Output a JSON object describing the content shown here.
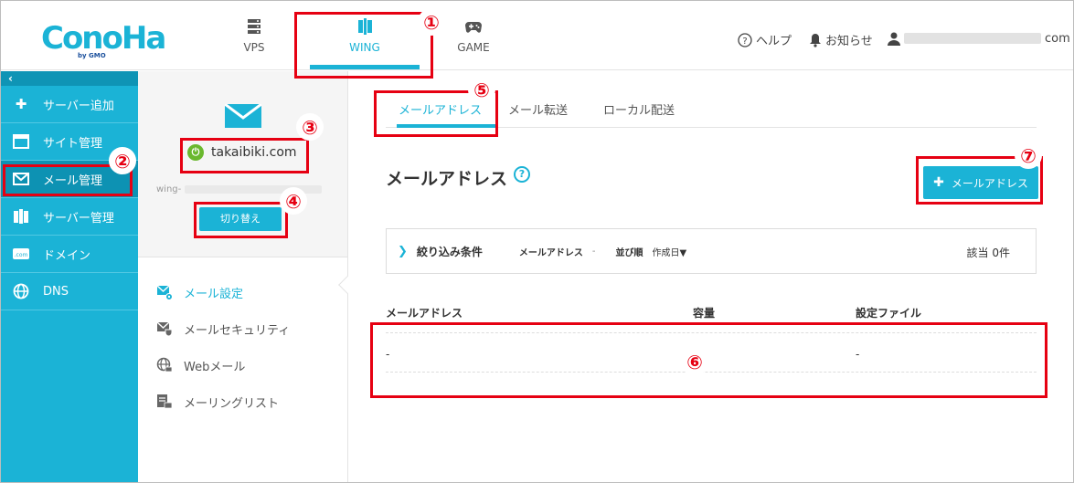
{
  "brand": {
    "logo_text": "ConoHa",
    "logo_sub": "by GMO"
  },
  "top_tabs": [
    {
      "label": "VPS"
    },
    {
      "label": "WING"
    },
    {
      "label": "GAME"
    }
  ],
  "header_utils": {
    "help": "ヘルプ",
    "news": "お知らせ",
    "account_suffix": "com"
  },
  "sidebar": {
    "collapse": "‹",
    "items": [
      {
        "label": "サーバー追加"
      },
      {
        "label": "サイト管理"
      },
      {
        "label": "メール管理"
      },
      {
        "label": "サーバー管理"
      },
      {
        "label": "ドメイン"
      },
      {
        "label": "DNS"
      }
    ]
  },
  "mid": {
    "domain": "takaibiki.com",
    "power_glyph": "⏻",
    "server_prefix": "wing-",
    "switch_button": "切り替え",
    "submenu": [
      {
        "label": "メール設定"
      },
      {
        "label": "メールセキュリティ"
      },
      {
        "label": "Webメール"
      },
      {
        "label": "メーリングリスト"
      }
    ]
  },
  "main": {
    "tabs": [
      {
        "label": "メールアドレス"
      },
      {
        "label": "メール転送"
      },
      {
        "label": "ローカル配送"
      }
    ],
    "title": "メールアドレス",
    "help_glyph": "?",
    "add_button": "メールアドレス",
    "filter": {
      "label": "絞り込み条件",
      "field_label": "メールアドレス",
      "field_value": "-",
      "sort_label": "並び順",
      "sort_value": "作成日▼",
      "count": "該当 0件"
    },
    "table": {
      "headers": [
        "メールアドレス",
        "容量",
        "設定ファイル"
      ],
      "rows": [
        [
          "-",
          "",
          "-"
        ]
      ]
    }
  },
  "annotations": [
    "①",
    "②",
    "③",
    "④",
    "⑤",
    "⑥",
    "⑦"
  ],
  "colors": {
    "accent": "#1bb3d6",
    "annotation": "#e60012",
    "power": "#6ab82e"
  }
}
